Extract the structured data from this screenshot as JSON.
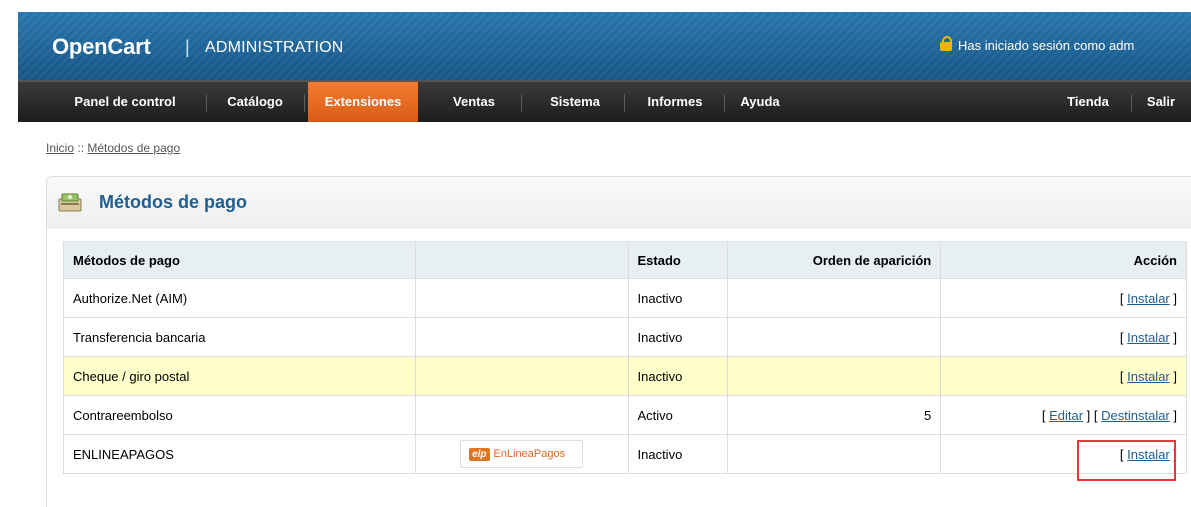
{
  "header": {
    "logo": "OpenCart",
    "separator": "|",
    "subtitle": "ADMINISTRATION",
    "login_text": "Has iniciado sesión como adm"
  },
  "menu": {
    "items": [
      "Panel de control",
      "Catálogo",
      "Extensiones",
      "Ventas",
      "Sistema",
      "Informes",
      "Ayuda"
    ],
    "right_items": [
      "Tienda",
      "Salir"
    ],
    "active": "Extensiones",
    "active_color": "#e46a22"
  },
  "breadcrumb": {
    "home": "Inicio",
    "separator": "::",
    "current": "Métodos de pago"
  },
  "panel": {
    "title": "Métodos de pago",
    "columns": [
      "Métodos de pago",
      "",
      "Estado",
      "Orden de aparición",
      "Acción"
    ],
    "rows": [
      {
        "name": "Authorize.Net (AIM)",
        "logo": "",
        "status": "Inactivo",
        "order": "",
        "actions": [
          "Instalar"
        ]
      },
      {
        "name": "Transferencia bancaria",
        "logo": "",
        "status": "Inactivo",
        "order": "",
        "actions": [
          "Instalar"
        ]
      },
      {
        "name": "Cheque / giro postal",
        "logo": "",
        "status": "Inactivo",
        "order": "",
        "actions": [
          "Instalar"
        ],
        "highlighted": true
      },
      {
        "name": "Contrareembolso",
        "logo": "",
        "status": "Activo",
        "order": "5",
        "actions": [
          "Editar",
          "Destinstalar"
        ]
      },
      {
        "name": "ENLINEAPAGOS",
        "logo": "EnLineaPagos",
        "logo_badge": "elp",
        "status": "Inactivo",
        "order": "",
        "actions": [
          "Instalar"
        ]
      }
    ]
  },
  "colors": {
    "header_blue": "#1b5f92",
    "link_blue": "#1e5e90",
    "highlight_row": "#ffffcc",
    "annotation_red": "#e23b3b"
  }
}
